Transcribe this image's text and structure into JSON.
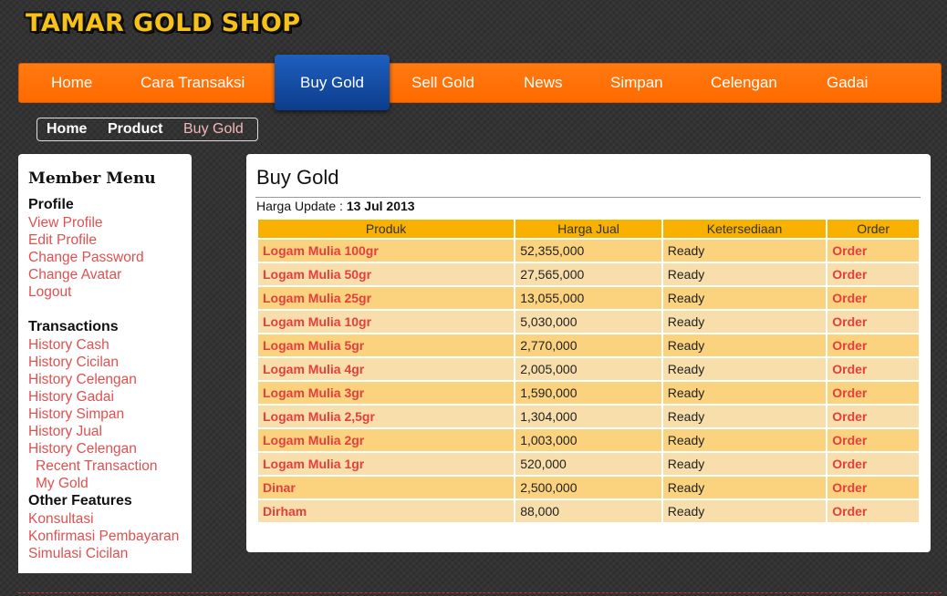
{
  "site": {
    "logo_text": "TAMAR GOLD SHOP"
  },
  "nav": {
    "items": [
      "Home",
      "Cara Transaksi",
      "Buy Gold",
      "Sell Gold",
      "News",
      "Simpan",
      "Celengan",
      "Gadai"
    ],
    "active": "Buy Gold",
    "colors": {
      "bar": "#ff6a00",
      "active": "#0c3d8c"
    }
  },
  "breadcrumb": {
    "items": [
      "Home",
      "Product",
      "Buy Gold"
    ]
  },
  "sidebar": {
    "title": "Member Menu",
    "profile": {
      "heading": "Profile",
      "links": [
        "View Profile",
        "Edit Profile",
        "Change Password",
        "Change Avatar",
        "Logout"
      ]
    },
    "transactions": {
      "heading": "Transactions",
      "links": [
        "History Cash",
        "History Cicilan",
        "History Celengan",
        "History Gadai",
        "History Simpan",
        "History Jual",
        "History Celengan"
      ],
      "sub_links": [
        "Recent Transaction",
        "My Gold"
      ]
    },
    "other": {
      "heading": "Other Features",
      "links": [
        "Konsultasi",
        "Konfirmasi Pembayaran",
        "Simulasi Cicilan"
      ]
    }
  },
  "main": {
    "title": "Buy Gold",
    "update_label": "Harga Update : ",
    "update_date": "13 Jul 2013",
    "table": {
      "headers": [
        "Produk",
        "Harga Jual",
        "Ketersediaan",
        "Order"
      ],
      "rows": [
        {
          "product": "Logam Mulia 100gr",
          "price": "52,355,000",
          "availability": "Ready",
          "order": "Order"
        },
        {
          "product": "Logam Mulia 50gr",
          "price": "27,565,000",
          "availability": "Ready",
          "order": "Order"
        },
        {
          "product": "Logam Mulia 25gr",
          "price": "13,055,000",
          "availability": "Ready",
          "order": "Order"
        },
        {
          "product": "Logam Mulia 10gr",
          "price": "5,030,000",
          "availability": "Ready",
          "order": "Order"
        },
        {
          "product": "Logam Mulia 5gr",
          "price": "2,770,000",
          "availability": "Ready",
          "order": "Order"
        },
        {
          "product": "Logam Mulia 4gr",
          "price": "2,005,000",
          "availability": "Ready",
          "order": "Order"
        },
        {
          "product": "Logam Mulia 3gr",
          "price": "1,590,000",
          "availability": "Ready",
          "order": "Order"
        },
        {
          "product": "Logam Mulia 2,5gr",
          "price": "1,304,000",
          "availability": "Ready",
          "order": "Order"
        },
        {
          "product": "Logam Mulia 2gr",
          "price": "1,003,000",
          "availability": "Ready",
          "order": "Order"
        },
        {
          "product": "Logam Mulia 1gr",
          "price": "520,000",
          "availability": "Ready",
          "order": "Order"
        },
        {
          "product": "Dinar",
          "price": "2,500,000",
          "availability": "Ready",
          "order": "Order"
        },
        {
          "product": "Dirham",
          "price": "88,000",
          "availability": "Ready",
          "order": "Order"
        }
      ]
    }
  }
}
